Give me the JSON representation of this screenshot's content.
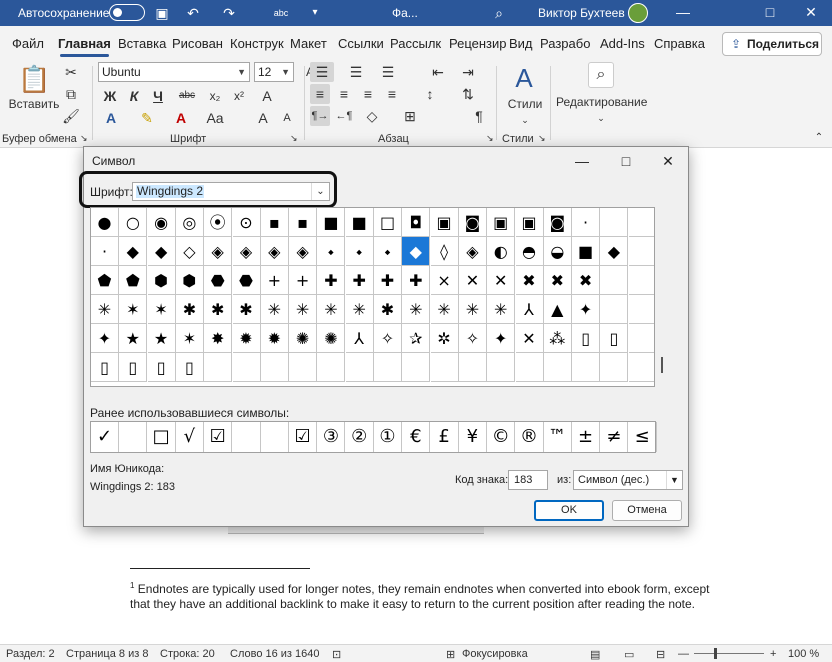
{
  "titlebar": {
    "autosave": "Автосохранение",
    "filename": "Фа...",
    "user": "Виктор Бухтеев",
    "qat_icons": [
      "save-icon",
      "undo-icon",
      "redo-icon",
      "abc-icon",
      "more-icon"
    ],
    "search_icon": "search-icon"
  },
  "tabs": [
    {
      "label": "Файл"
    },
    {
      "label": "Главная"
    },
    {
      "label": "Вставка"
    },
    {
      "label": "Рисован"
    },
    {
      "label": "Конструк"
    },
    {
      "label": "Макет"
    },
    {
      "label": "Ссылки"
    },
    {
      "label": "Рассылк"
    },
    {
      "label": "Рецензир"
    },
    {
      "label": "Вид"
    },
    {
      "label": "Разрабо"
    },
    {
      "label": "Add-Ins"
    },
    {
      "label": "Справка"
    }
  ],
  "share_label": "Поделиться",
  "ribbon": {
    "paste_label": "Вставить",
    "clipboard": "Буфер обмена",
    "font_group": "Шрифт",
    "para_group": "Абзац",
    "styles_group": "Стили",
    "font_name": "Ubuntu",
    "font_size": "12",
    "bold": "Ж",
    "italic": "К",
    "underline": "Ч",
    "strike": "abc",
    "sub": "x₂",
    "sup": "x²",
    "styles_label": "Стили",
    "editing_label": "Редактирование",
    "pilcrow": "¶"
  },
  "status": {
    "section": "Раздел: 2",
    "page": "Страница 8 из 8",
    "line": "Строка: 20",
    "words": "Слово 16 из 1640",
    "focus": "Фокусировка",
    "zoom": "100 %"
  },
  "document": {
    "endnote_mark": "1",
    "endnote_text": "Endnotes are typically used for longer notes, they remain endnotes when converted into ebook form, except that they have an additional backlink to make it easy to return to the current position after reading the note."
  },
  "dialog": {
    "title": "Символ",
    "font_label": "Шрифт:",
    "font_value": "Wingdings 2",
    "recent_label": "Ранее использовавшиеся символы:",
    "unicode_name_label": "Имя Юникода:",
    "unicode_name_value": "Wingdings 2: 183",
    "code_label": "Код знака:",
    "code_value": "183",
    "from_label": "из:",
    "from_value": "Символ (дес.)",
    "ok": "OK",
    "cancel": "Отмена"
  },
  "grid_rows": [
    [
      "●",
      "○",
      "◉",
      "◎",
      "⦿",
      "⊙",
      "▪",
      "▪",
      "■",
      "■",
      "□",
      "◘",
      "▣",
      "◙",
      "▣",
      "▣",
      "◙",
      "·"
    ],
    [
      "·",
      "◆",
      "◆",
      "◇",
      "◈",
      "◈",
      "◈",
      "◈",
      "⬩",
      "⬩",
      "⬩",
      "◆",
      "◊",
      "◈",
      "◐",
      "◓",
      "◒",
      "■",
      "◆"
    ],
    [
      "⬟",
      "⬟",
      "⬢",
      "⬢",
      "⬣",
      "⬣",
      "+",
      "+",
      "✚",
      "✚",
      "✚",
      "✚",
      "×",
      "✕",
      "✕",
      "✖",
      "✖",
      "✖"
    ],
    [
      "✳",
      "✶",
      "✶",
      "✱",
      "✱",
      "✱",
      "✳",
      "✳",
      "✳",
      "✳",
      "✱",
      "✳",
      "✳",
      "✳",
      "✳",
      "⅄",
      "▲",
      "✦"
    ],
    [
      "✦",
      "★",
      "★",
      "✶",
      "✸",
      "✹",
      "✹",
      "✺",
      "✺",
      "⅄",
      "✧",
      "✰",
      "✲",
      "✧",
      "✦",
      "✕",
      "⁂",
      "▯",
      "▯"
    ],
    [
      "▯",
      "▯",
      "▯",
      "▯"
    ]
  ],
  "recent": [
    "✓",
    "",
    "□",
    "√",
    "☑",
    "",
    "",
    "☑",
    "③",
    "②",
    "①",
    "€",
    "£",
    "¥",
    "©",
    "®",
    "™",
    "±",
    "≠",
    "≤"
  ]
}
